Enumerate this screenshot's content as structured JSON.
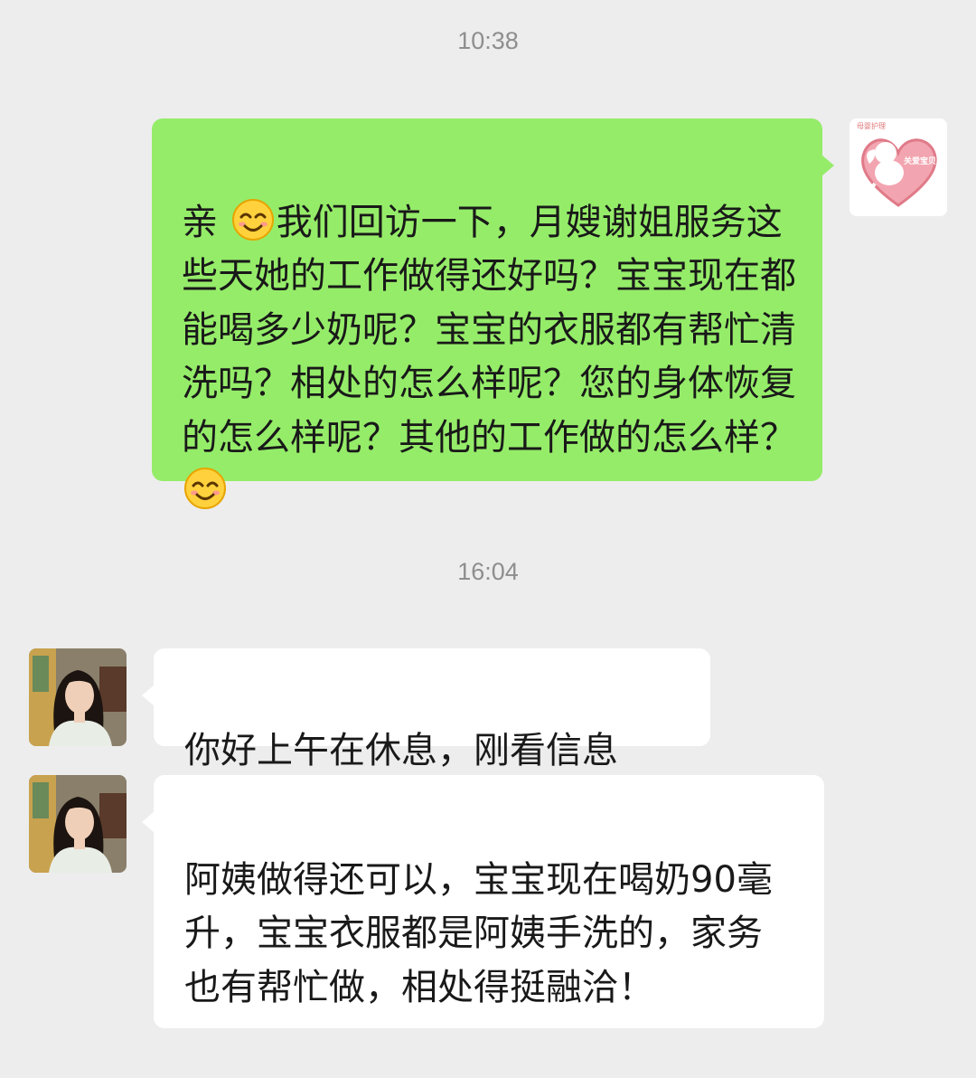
{
  "timestamps": {
    "first": "10:38",
    "second": "16:04"
  },
  "messages": [
    {
      "sender": "self",
      "segments": [
        "亲 ",
        "我们回访一下，月嫂谢姐服务这些天她的工作做得还好吗？宝宝现在都能喝多少奶呢？宝宝的衣服都有帮忙清洗吗？相处的怎么样呢？您的身体恢复的怎么样呢？其他的工作做的怎么样？"
      ],
      "emoji": "smiling-face-emoji"
    },
    {
      "sender": "contact",
      "text": "你好上午在休息，刚看信息"
    },
    {
      "sender": "contact",
      "text": "阿姨做得还可以，宝宝现在喝奶90毫升，宝宝衣服都是阿姨手洗的，家务也有帮忙做，相处得挺融洽！"
    }
  ],
  "self_avatar": {
    "icon": "cherub-heart-logo",
    "logo_text_top": "母婴护理",
    "logo_text_heart": "关爱宝贝"
  },
  "contact_avatar": {
    "icon": "woman-portrait"
  },
  "colors": {
    "background": "#ededed",
    "sent_bubble": "#95ec69",
    "received_bubble": "#ffffff",
    "timestamp": "#8e8e8e"
  }
}
